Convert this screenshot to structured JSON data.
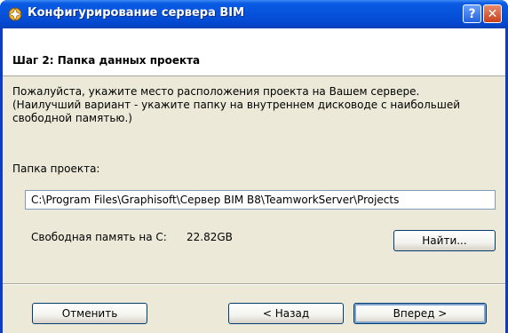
{
  "window": {
    "title": "Конфигурирование сервера BIM",
    "icon": "bim-server-icon",
    "help_glyph": "?",
    "close_glyph": "✕"
  },
  "header": {
    "step_title": "Шаг 2: Папка данных проекта"
  },
  "description": {
    "line1": "Пожалуйста, укажите место расположения проекта на Вашем сервере.",
    "line2": "(Наилучший вариант - укажите папку на внутреннем дисководе с наибольшей",
    "line3": "свободной памятью.)"
  },
  "folder": {
    "label": "Папка проекта:",
    "path_value": "C:\\Program Files\\Graphisoft\\Сервер BIM B8\\TeamworkServer\\Projects"
  },
  "free_space": {
    "label": "Свободная память на C:",
    "value": "22.82GB"
  },
  "buttons": {
    "find": "Найти...",
    "cancel": "Отменить",
    "back": "< Назад",
    "next": "Вперед >"
  }
}
